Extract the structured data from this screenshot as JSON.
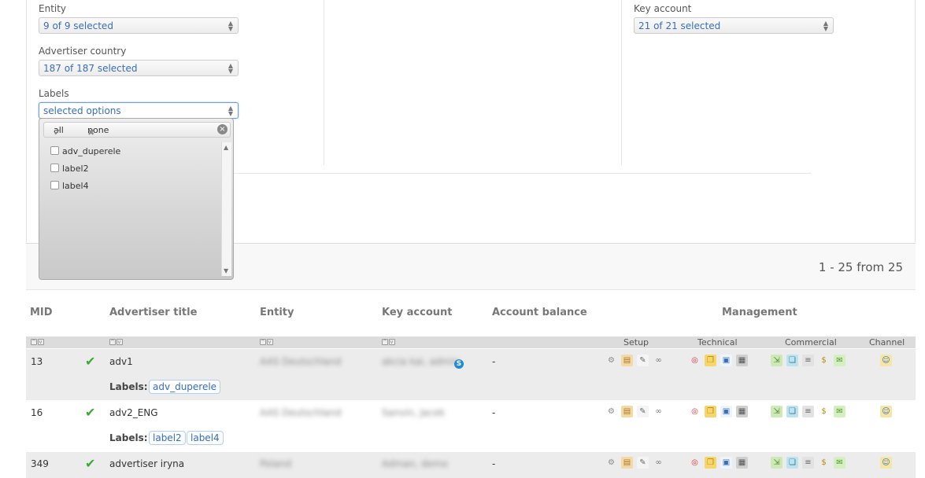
{
  "filters": {
    "entity": {
      "label": "Entity",
      "value": "9 of 9 selected"
    },
    "advertiser_country": {
      "label": "Advertiser country",
      "value": "187 of 187 selected"
    },
    "labels": {
      "label": "Labels",
      "value": "selected options"
    },
    "key_account": {
      "label": "Key account",
      "value": "21 of 21 selected"
    }
  },
  "labels_dropdown": {
    "all": "all",
    "none": "none",
    "options": [
      "adv_duperele",
      "label2",
      "label4"
    ]
  },
  "pager": {
    "text": "1 - 25 from 25"
  },
  "table": {
    "headers": {
      "mid": "MID",
      "title": "Advertiser title",
      "entity": "Entity",
      "key_account": "Key account",
      "balance": "Account balance",
      "management": "Management"
    },
    "groups": {
      "setup": "Setup",
      "technical": "Technical",
      "commercial": "Commercial",
      "channel": "Channel"
    },
    "labels_caption": "Labels:",
    "rows": [
      {
        "mid": "13",
        "title": "adv1",
        "entity": "AAS Deutschland",
        "key_account": "akcia kai, admin",
        "balance": "-",
        "labels": [
          "adv_duperele"
        ]
      },
      {
        "mid": "16",
        "title": "adv2_ENG",
        "entity": "AAS Deutschland",
        "key_account": "Sanvin, Jacek",
        "balance": "-",
        "labels": [
          "label2",
          "label4"
        ]
      },
      {
        "mid": "349",
        "title": "advertiser iryna",
        "entity": "Poland",
        "key_account": "Adman, demo",
        "balance": "-",
        "labels": []
      }
    ]
  },
  "colors": {
    "accent": "#3a6eb6",
    "check": "#3aaa35",
    "skype": "#1f8ad6"
  },
  "icons": {
    "setup": [
      "gear-icon",
      "settings-icon",
      "edit-icon",
      "link-icon"
    ],
    "technical": [
      "target-icon",
      "pages-icon",
      "document-icon",
      "monitor-icon"
    ],
    "commercial": [
      "export-icon",
      "screens-icon",
      "list-icon",
      "dollar-icon",
      "money-icon"
    ],
    "channel": [
      "user-icon"
    ]
  }
}
